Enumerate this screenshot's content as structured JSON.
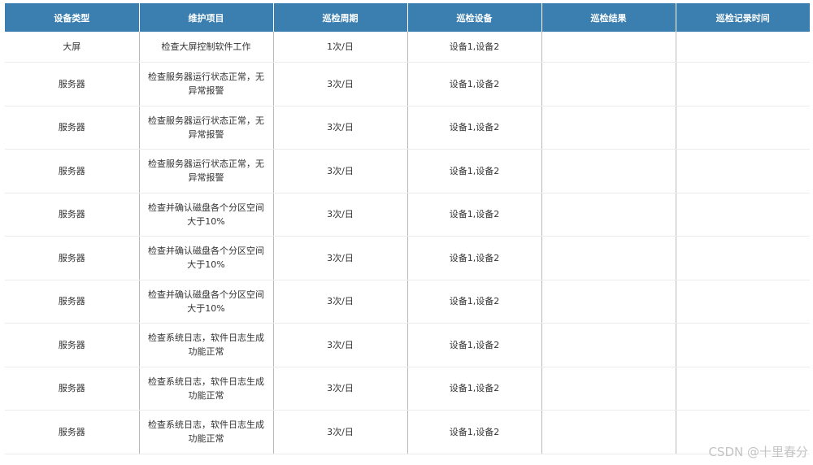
{
  "table": {
    "headers": [
      "设备类型",
      "维护项目",
      "巡检周期",
      "巡检设备",
      "巡检结果",
      "巡检记录时间"
    ],
    "rows": [
      {
        "device_type": "大屏",
        "item": "检查大屏控制软件工作",
        "cycle": "1次/日",
        "devices": "设备1,设备2",
        "result": "",
        "record_time": ""
      },
      {
        "device_type": "服务器",
        "item": "检查服务器运行状态正常，无异常报警",
        "cycle": "3次/日",
        "devices": "设备1,设备2",
        "result": "",
        "record_time": ""
      },
      {
        "device_type": "服务器",
        "item": "检查服务器运行状态正常，无异常报警",
        "cycle": "3次/日",
        "devices": "设备1,设备2",
        "result": "",
        "record_time": ""
      },
      {
        "device_type": "服务器",
        "item": "检查服务器运行状态正常，无异常报警",
        "cycle": "3次/日",
        "devices": "设备1,设备2",
        "result": "",
        "record_time": ""
      },
      {
        "device_type": "服务器",
        "item": "检查并确认磁盘各个分区空间大于10%",
        "cycle": "3次/日",
        "devices": "设备1,设备2",
        "result": "",
        "record_time": ""
      },
      {
        "device_type": "服务器",
        "item": "检查并确认磁盘各个分区空间大于10%",
        "cycle": "3次/日",
        "devices": "设备1,设备2",
        "result": "",
        "record_time": ""
      },
      {
        "device_type": "服务器",
        "item": "检查并确认磁盘各个分区空间大于10%",
        "cycle": "3次/日",
        "devices": "设备1,设备2",
        "result": "",
        "record_time": ""
      },
      {
        "device_type": "服务器",
        "item": "检查系统日志，软件日志生成功能正常",
        "cycle": "3次/日",
        "devices": "设备1,设备2",
        "result": "",
        "record_time": ""
      },
      {
        "device_type": "服务器",
        "item": "检查系统日志，软件日志生成功能正常",
        "cycle": "3次/日",
        "devices": "设备1,设备2",
        "result": "",
        "record_time": ""
      },
      {
        "device_type": "服务器",
        "item": "检查系统日志，软件日志生成功能正常",
        "cycle": "3次/日",
        "devices": "设备1,设备2",
        "result": "",
        "record_time": ""
      }
    ]
  },
  "watermark": "CSDN @十里春分",
  "colors": {
    "header_bg": "#3a7fb0",
    "header_text": "#ffffff",
    "cell_text": "#333333",
    "divider": "#b9b9b9"
  }
}
